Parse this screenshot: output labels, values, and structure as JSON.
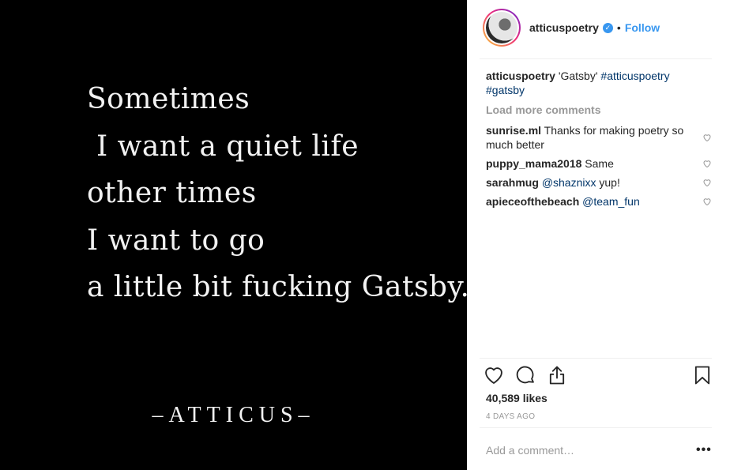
{
  "post_image": {
    "poem_lines": [
      "Sometimes",
      " I want a quiet life",
      "other times",
      "I want to go",
      "a little bit fucking Gatsby."
    ],
    "signature": "–ATTICUS–"
  },
  "header": {
    "username": "atticuspoetry",
    "verified_icon": "verified-badge-icon",
    "verified_glyph": "✓",
    "separator": "•",
    "follow_label": "Follow"
  },
  "caption": {
    "username": "atticuspoetry",
    "text": "'Gatsby'",
    "hashtag_1": "#atticuspoetry",
    "hashtag_2": "#gatsby"
  },
  "load_more": "Load more comments",
  "comments": [
    {
      "user": "sunrise.ml",
      "text": "Thanks for making poetry so much better",
      "mention": ""
    },
    {
      "user": "puppy_mama2018",
      "text": "Same",
      "mention": ""
    },
    {
      "user": "sarahmug",
      "text": "yup!",
      "mention": "@shaznixx"
    },
    {
      "user": "apieceofthebeach",
      "text": "",
      "mention": "@team_fun"
    }
  ],
  "actions": {
    "like_icon": "heart-icon",
    "comment_icon": "comment-icon",
    "share_icon": "share-icon",
    "save_icon": "bookmark-icon"
  },
  "likes": "40,589 likes",
  "timestamp": "4 DAYS AGO",
  "comment_input": {
    "placeholder": "Add a comment…"
  },
  "more_options": "•••",
  "colors": {
    "accent": "#3897f0",
    "hashtag": "#003569",
    "muted": "#999999",
    "image_bg": "#000000"
  }
}
